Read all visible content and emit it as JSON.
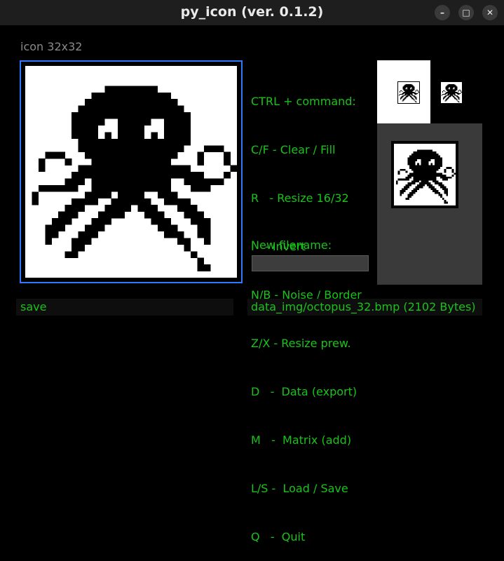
{
  "window": {
    "title": "py_icon (ver. 0.1.2)",
    "controls": [
      "minimize",
      "maximize",
      "close"
    ]
  },
  "editor": {
    "caption": "icon 32x32"
  },
  "help": {
    "header": "CTRL + command:",
    "lines": [
      "C/F - Clear / Fill",
      "R   - Resize 16/32",
      "I   - Invert",
      "N/B - Noise / Border",
      "Z/X - Resize prew.",
      "D   -  Data (export)",
      "M   -  Matrix (add)",
      "L/S -  Load / Save",
      "Q   -  Quit"
    ]
  },
  "filename": {
    "label": "New filename:",
    "value": ""
  },
  "status": {
    "left": "save",
    "right": "data_img/octopus_32.bmp (2102 Bytes)"
  },
  "colors": {
    "accent_green": "#19c319",
    "canvas_border": "#2f78ff",
    "panel_gray": "#3a3a3a"
  },
  "icon_rows": [
    "................................",
    "................................",
    "................................",
    "............XXXXXXXX............",
    "..........XXXXXXXXXXXX..........",
    ".........XXXXXXXXXXXXXX.........",
    "........XXXXXXXXXXXXXXXX........",
    ".......XXXXXXXXXXXXXXXXXX.......",
    ".......XXXXX..XXXXX..XXXX.......",
    ".......XXXX...XXXX...XXXX.......",
    ".......XXXX.X.XXXX.X.XXXX.......",
    "........XXXXXXXXXXXXXXXXX.......",
    "........XXXXXXXXXXXXXXXX...XXX..",
    "...XXX...XXXXXXXXXXXXXX...X...X.",
    "..X...X...XXXXXXXXXXXX....X...X.",
    "..X.....XXXXXXXXXXXXXXXXX......X",
    ".......XXXXXXXXXXXXXXXXXXXX...X.",
    "......XXX.XXXXXXXXXXXX..XXXXXX..",
    "..XXXXXX..XXXXXXXXXXXX...XXX....",
    ".X.......XXXX.XXXX..XXX.........",
    ".X.....XXXX..XXXXXX..XXXX.......",
    "......XXX...XXXX.XXX...XXX......",
    ".....XXX...XXXX...XXX...XXX.....",
    "....XXX...XXX......XXX...XXX....",
    "...XXX...XXX........XXX...XX....",
    "...XX...XXX..........XXX..XX....",
    "...X...XXX.............XX..X....",
    ".......XX...............X.......",
    "......XX.................X......",
    "..........................X.....",
    "..........................XX....",
    "................................"
  ]
}
